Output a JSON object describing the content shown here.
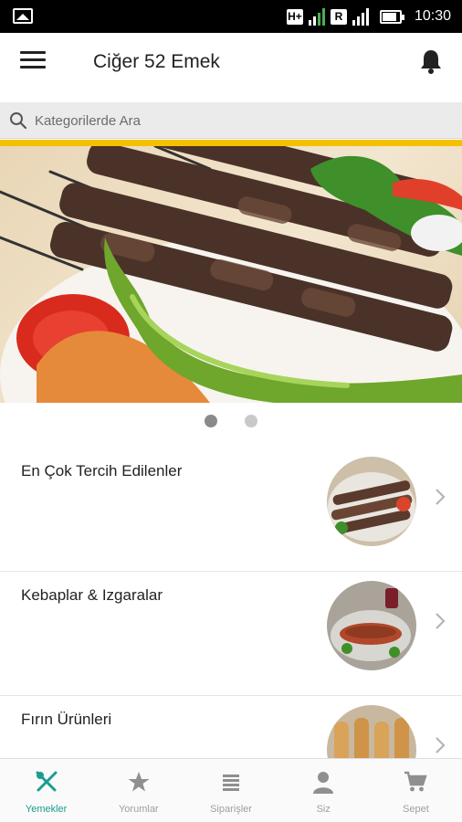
{
  "status_bar": {
    "network_labels": [
      "H+",
      "R"
    ],
    "time": "10:30"
  },
  "app_bar": {
    "title": "Ciğer 52 Emek",
    "menu_icon": "hamburger-menu-icon",
    "bell_icon": "notification-bell-icon"
  },
  "search": {
    "placeholder": "Kategorilerde Ara"
  },
  "banner": {
    "slide_count": 2,
    "active_slide": 1
  },
  "categories": [
    {
      "label": "En Çok Tercih Edilenler"
    },
    {
      "label": "Kebaplar & Izgaralar"
    },
    {
      "label": "Fırın Ürünleri"
    }
  ],
  "bottom_nav": {
    "active": "Yemekler",
    "items": [
      {
        "label": "Yemekler",
        "icon": "fork-knife-icon"
      },
      {
        "label": "Yorumlar",
        "icon": "star-icon"
      },
      {
        "label": "Siparişler",
        "icon": "list-icon"
      },
      {
        "label": "Siz",
        "icon": "person-icon"
      },
      {
        "label": "Sepet",
        "icon": "cart-icon"
      }
    ]
  },
  "colors": {
    "accent": "#1a9d8f",
    "strip": "#f5c000",
    "status_bar": "#000000"
  }
}
